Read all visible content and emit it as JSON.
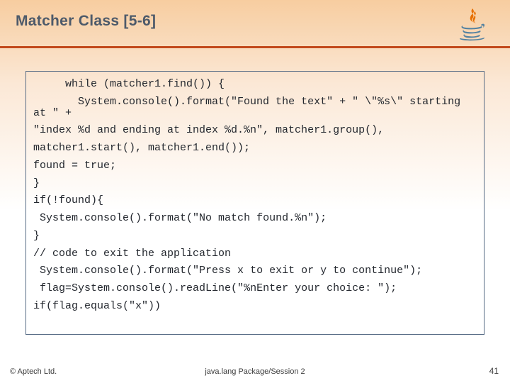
{
  "title": "Matcher Class [5-6]",
  "code_lines": [
    "     while (matcher1.find()) {",
    "       System.console().format(\"Found the text\" + \" \\\"%s\\\" starting at \" +",
    "\"index %d and ending at index %d.%n\", matcher1.group(),",
    "matcher1.start(), matcher1.end());",
    "found = true;",
    "}",
    "if(!found){",
    " System.console().format(\"No match found.%n\");",
    "}",
    "// code to exit the application",
    " System.console().format(\"Press x to exit or y to continue\");",
    " flag=System.console().readLine(\"%nEnter your choice: \");",
    "if(flag.equals(\"x\"))"
  ],
  "footer": {
    "copyright": "© Aptech Ltd.",
    "center": "java.lang Package/Session 2",
    "page": "41"
  }
}
